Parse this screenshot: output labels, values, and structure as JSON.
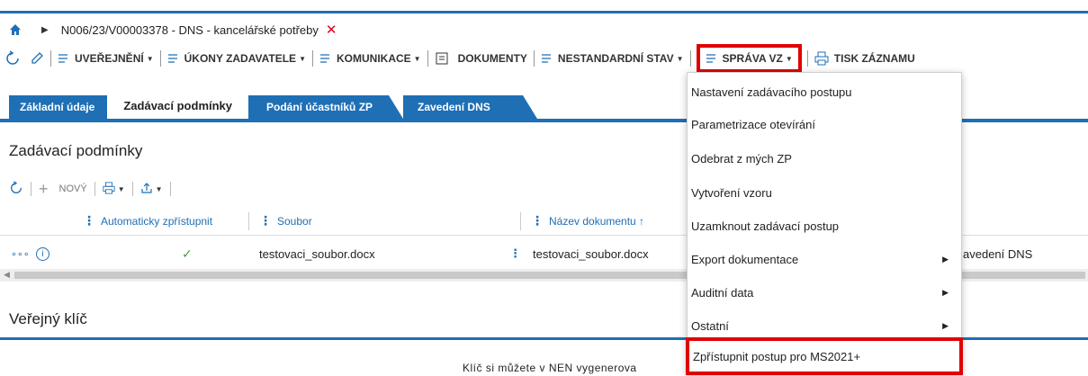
{
  "breadcrumb": {
    "title": "N006/23/V00003378 - DNS - kancelářské potřeby",
    "close_glyph": "✕"
  },
  "toolbar": {
    "uverejneni": "UVEŘEJNĚNÍ",
    "ukony": "ÚKONY ZADAVATELE",
    "komunikace": "KOMUNIKACE",
    "dokumenty": "DOKUMENTY",
    "nestandardni": "NESTANDARDNÍ STAV",
    "sprava": "SPRÁVA VZ",
    "tisk": "TISK ZÁZNAMU"
  },
  "tabs": [
    "Základní údaje",
    "Zadávací podmínky",
    "Podání účastníků ZP",
    "Zavedení DNS"
  ],
  "section1": {
    "title": "Zadávací podmínky"
  },
  "grid_toolbar": {
    "new_label": "NOVÝ"
  },
  "grid": {
    "columns": [
      "Automaticky zpřístupnit",
      "Soubor",
      "Název dokumentu ↑"
    ],
    "row": {
      "check": "✓",
      "soubor": "testovaci_soubor.docx",
      "nazev": "testovaci_soubor.docx",
      "extra": "avedení DNS",
      "more": "∘∘∘",
      "info": "i"
    }
  },
  "section2": {
    "title": "Veřejný klíč"
  },
  "footer": {
    "text": "Klíč si můžete v NEN vygenerova"
  },
  "menu": {
    "items": [
      "Nastavení zadávacího postupu",
      "Parametrizace otevírání",
      "Odebrat z mých ZP",
      "Vytvoření vzoru",
      "Uzamknout zadávací postup",
      "Export dokumentace",
      "Auditní data",
      "Ostatní",
      "Zpřístupnit postup pro MS2021+"
    ],
    "submenu_glyph": "▶"
  },
  "colors": {
    "accent": "#1f6fb5",
    "highlight": "#e00000",
    "close": "#e0001b",
    "check": "#3aa835"
  }
}
